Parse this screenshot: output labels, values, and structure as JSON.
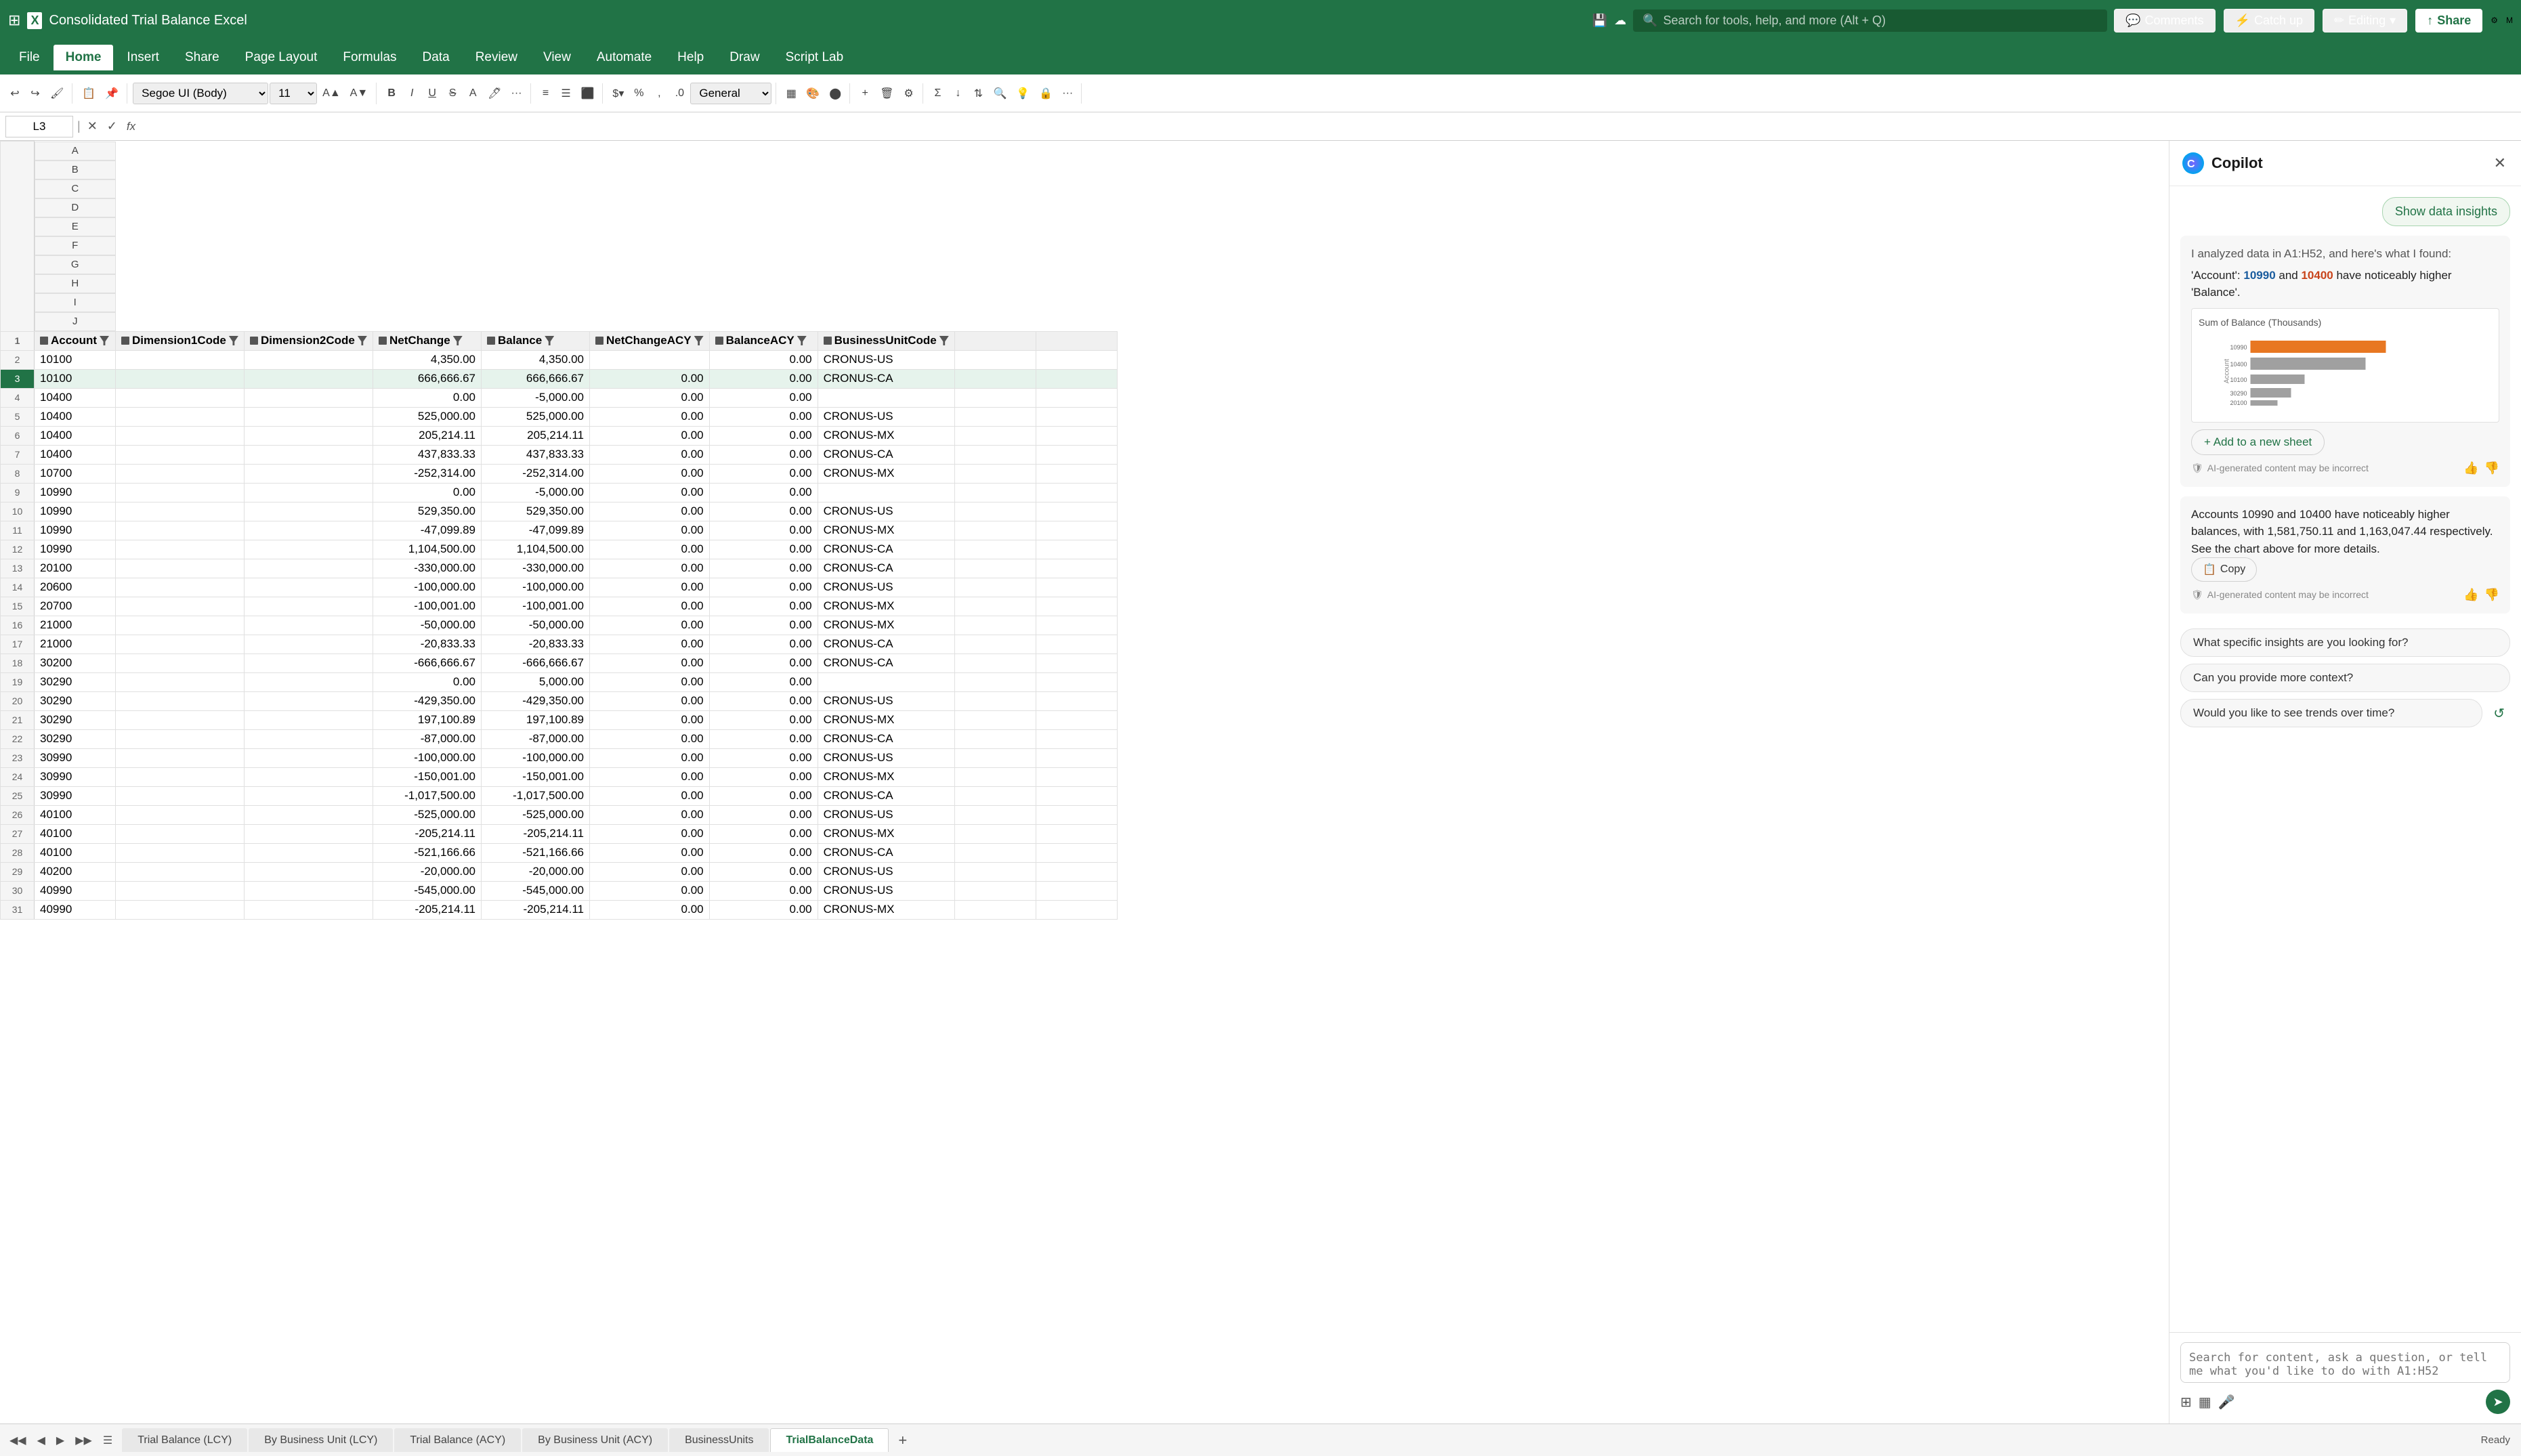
{
  "titleBar": {
    "appName": "Consolidated Trial Balance Excel",
    "searchPlaceholder": "Search for tools, help, and more (Alt + Q)",
    "waffleLabel": "⊞",
    "comments": "Comments",
    "catchup": "Catch up",
    "editing": "Editing",
    "share": "Share",
    "chevronDown": "▾"
  },
  "ribbonTabs": [
    {
      "label": "File",
      "active": false
    },
    {
      "label": "Home",
      "active": true
    },
    {
      "label": "Insert",
      "active": false
    },
    {
      "label": "Share",
      "active": false
    },
    {
      "label": "Page Layout",
      "active": false
    },
    {
      "label": "Formulas",
      "active": false
    },
    {
      "label": "Data",
      "active": false
    },
    {
      "label": "Review",
      "active": false
    },
    {
      "label": "View",
      "active": false
    },
    {
      "label": "Automate",
      "active": false
    },
    {
      "label": "Help",
      "active": false
    },
    {
      "label": "Draw",
      "active": false
    },
    {
      "label": "Script Lab",
      "active": false
    }
  ],
  "formulaBar": {
    "cellRef": "L3",
    "formula": ""
  },
  "fontSelector": "Segoe UI (Body)",
  "fontSize": "11",
  "numberFormat": "General",
  "columns": [
    {
      "label": "A",
      "width": 120
    },
    {
      "label": "B",
      "width": 190
    },
    {
      "label": "C",
      "width": 190
    },
    {
      "label": "D",
      "width": 160
    },
    {
      "label": "E",
      "width": 160
    },
    {
      "label": "F",
      "width": 160
    },
    {
      "label": "G",
      "width": 160
    },
    {
      "label": "H",
      "width": 180
    },
    {
      "label": "I",
      "width": 120
    },
    {
      "label": "J",
      "width": 120
    }
  ],
  "tableHeaders": [
    "Account",
    "Dimension1Code",
    "Dimension2Code",
    "NetChange",
    "Balance",
    "NetChangeACY",
    "BalanceACY",
    "BusinessUnitCode",
    "",
    ""
  ],
  "tableData": [
    {
      "row": 2,
      "a": "10100",
      "b": "",
      "c": "",
      "d": "4,350.00",
      "e": "4,350.00",
      "f": "",
      "g": "0.00",
      "h": "CRONUS-US",
      "selected": false
    },
    {
      "row": 3,
      "a": "10100",
      "b": "",
      "c": "",
      "d": "666,666.67",
      "e": "666,666.67",
      "f": "0.00",
      "g": "0.00",
      "h": "CRONUS-CA",
      "selected": true
    },
    {
      "row": 4,
      "a": "10400",
      "b": "",
      "c": "",
      "d": "0.00",
      "e": "-5,000.00",
      "f": "0.00",
      "g": "0.00",
      "h": "",
      "selected": false
    },
    {
      "row": 5,
      "a": "10400",
      "b": "",
      "c": "",
      "d": "525,000.00",
      "e": "525,000.00",
      "f": "0.00",
      "g": "0.00",
      "h": "CRONUS-US",
      "selected": false
    },
    {
      "row": 6,
      "a": "10400",
      "b": "",
      "c": "",
      "d": "205,214.11",
      "e": "205,214.11",
      "f": "0.00",
      "g": "0.00",
      "h": "CRONUS-MX",
      "selected": false
    },
    {
      "row": 7,
      "a": "10400",
      "b": "",
      "c": "",
      "d": "437,833.33",
      "e": "437,833.33",
      "f": "0.00",
      "g": "0.00",
      "h": "CRONUS-CA",
      "selected": false
    },
    {
      "row": 8,
      "a": "10700",
      "b": "",
      "c": "",
      "d": "-252,314.00",
      "e": "-252,314.00",
      "f": "0.00",
      "g": "0.00",
      "h": "CRONUS-MX",
      "selected": false
    },
    {
      "row": 9,
      "a": "10990",
      "b": "",
      "c": "",
      "d": "0.00",
      "e": "-5,000.00",
      "f": "0.00",
      "g": "0.00",
      "h": "",
      "selected": false
    },
    {
      "row": 10,
      "a": "10990",
      "b": "",
      "c": "",
      "d": "529,350.00",
      "e": "529,350.00",
      "f": "0.00",
      "g": "0.00",
      "h": "CRONUS-US",
      "selected": false
    },
    {
      "row": 11,
      "a": "10990",
      "b": "",
      "c": "",
      "d": "-47,099.89",
      "e": "-47,099.89",
      "f": "0.00",
      "g": "0.00",
      "h": "CRONUS-MX",
      "selected": false
    },
    {
      "row": 12,
      "a": "10990",
      "b": "",
      "c": "",
      "d": "1,104,500.00",
      "e": "1,104,500.00",
      "f": "0.00",
      "g": "0.00",
      "h": "CRONUS-CA",
      "selected": false
    },
    {
      "row": 13,
      "a": "20100",
      "b": "",
      "c": "",
      "d": "-330,000.00",
      "e": "-330,000.00",
      "f": "0.00",
      "g": "0.00",
      "h": "CRONUS-CA",
      "selected": false
    },
    {
      "row": 14,
      "a": "20600",
      "b": "",
      "c": "",
      "d": "-100,000.00",
      "e": "-100,000.00",
      "f": "0.00",
      "g": "0.00",
      "h": "CRONUS-US",
      "selected": false
    },
    {
      "row": 15,
      "a": "20700",
      "b": "",
      "c": "",
      "d": "-100,001.00",
      "e": "-100,001.00",
      "f": "0.00",
      "g": "0.00",
      "h": "CRONUS-MX",
      "selected": false
    },
    {
      "row": 16,
      "a": "21000",
      "b": "",
      "c": "",
      "d": "-50,000.00",
      "e": "-50,000.00",
      "f": "0.00",
      "g": "0.00",
      "h": "CRONUS-MX",
      "selected": false
    },
    {
      "row": 17,
      "a": "21000",
      "b": "",
      "c": "",
      "d": "-20,833.33",
      "e": "-20,833.33",
      "f": "0.00",
      "g": "0.00",
      "h": "CRONUS-CA",
      "selected": false
    },
    {
      "row": 18,
      "a": "30200",
      "b": "",
      "c": "",
      "d": "-666,666.67",
      "e": "-666,666.67",
      "f": "0.00",
      "g": "0.00",
      "h": "CRONUS-CA",
      "selected": false
    },
    {
      "row": 19,
      "a": "30290",
      "b": "",
      "c": "",
      "d": "0.00",
      "e": "5,000.00",
      "f": "0.00",
      "g": "0.00",
      "h": "",
      "selected": false
    },
    {
      "row": 20,
      "a": "30290",
      "b": "",
      "c": "",
      "d": "-429,350.00",
      "e": "-429,350.00",
      "f": "0.00",
      "g": "0.00",
      "h": "CRONUS-US",
      "selected": false
    },
    {
      "row": 21,
      "a": "30290",
      "b": "",
      "c": "",
      "d": "197,100.89",
      "e": "197,100.89",
      "f": "0.00",
      "g": "0.00",
      "h": "CRONUS-MX",
      "selected": false
    },
    {
      "row": 22,
      "a": "30290",
      "b": "",
      "c": "",
      "d": "-87,000.00",
      "e": "-87,000.00",
      "f": "0.00",
      "g": "0.00",
      "h": "CRONUS-CA",
      "selected": false
    },
    {
      "row": 23,
      "a": "30990",
      "b": "",
      "c": "",
      "d": "-100,000.00",
      "e": "-100,000.00",
      "f": "0.00",
      "g": "0.00",
      "h": "CRONUS-US",
      "selected": false
    },
    {
      "row": 24,
      "a": "30990",
      "b": "",
      "c": "",
      "d": "-150,001.00",
      "e": "-150,001.00",
      "f": "0.00",
      "g": "0.00",
      "h": "CRONUS-MX",
      "selected": false
    },
    {
      "row": 25,
      "a": "30990",
      "b": "",
      "c": "",
      "d": "-1,017,500.00",
      "e": "-1,017,500.00",
      "f": "0.00",
      "g": "0.00",
      "h": "CRONUS-CA",
      "selected": false
    },
    {
      "row": 26,
      "a": "40100",
      "b": "",
      "c": "",
      "d": "-525,000.00",
      "e": "-525,000.00",
      "f": "0.00",
      "g": "0.00",
      "h": "CRONUS-US",
      "selected": false
    },
    {
      "row": 27,
      "a": "40100",
      "b": "",
      "c": "",
      "d": "-205,214.11",
      "e": "-205,214.11",
      "f": "0.00",
      "g": "0.00",
      "h": "CRONUS-MX",
      "selected": false
    },
    {
      "row": 28,
      "a": "40100",
      "b": "",
      "c": "",
      "d": "-521,166.66",
      "e": "-521,166.66",
      "f": "0.00",
      "g": "0.00",
      "h": "CRONUS-CA",
      "selected": false
    },
    {
      "row": 29,
      "a": "40200",
      "b": "",
      "c": "",
      "d": "-20,000.00",
      "e": "-20,000.00",
      "f": "0.00",
      "g": "0.00",
      "h": "CRONUS-US",
      "selected": false
    },
    {
      "row": 30,
      "a": "40990",
      "b": "",
      "c": "",
      "d": "-545,000.00",
      "e": "-545,000.00",
      "f": "0.00",
      "g": "0.00",
      "h": "CRONUS-US",
      "selected": false
    },
    {
      "row": 31,
      "a": "40990",
      "b": "",
      "c": "",
      "d": "-205,214.11",
      "e": "-205,214.11",
      "f": "0.00",
      "g": "0.00",
      "h": "CRONUS-MX",
      "selected": false
    }
  ],
  "copilot": {
    "title": "Copilot",
    "showDataInsights": "Show data insights",
    "analyzedNote": "I analyzed data in A1:H52, and here's what I found:",
    "insightText1a": "'Account': ",
    "insightHighlight1": "10990",
    "insightText1b": " and ",
    "insightHighlight2": "10400",
    "insightText1c": " have noticeably higher 'Balance'.",
    "chartTitle": "Sum of Balance (Thousands)",
    "addToSheet": "+ Add to a new sheet",
    "aiDisclaimer": "AI-generated content may be incorrect",
    "insight2": "Accounts 10990 and 10400 have noticeably higher balances, with 1,581,750.11 and 1,163,047.44 respectively. See the chart above for more details.",
    "copyLabel": "Copy",
    "aiDisclaimer2": "AI-generated content may be incorrect",
    "suggestion1": "What specific insights are you looking for?",
    "suggestion2": "Can you provide more context?",
    "suggestion3": "Would you like to see trends over time?",
    "inputPlaceholder": "Search for content, ask a question, or tell me what you'd like to do with A1:H52",
    "icons": {
      "grid": "⊞",
      "table": "▦",
      "mic": "🎤",
      "send": "➤"
    }
  },
  "sheetTabs": [
    {
      "label": "Trial Balance (LCY)",
      "active": false
    },
    {
      "label": "By Business Unit (LCY)",
      "active": false
    },
    {
      "label": "Trial Balance (ACY)",
      "active": false
    },
    {
      "label": "By Business Unit (ACY)",
      "active": false
    },
    {
      "label": "BusinessUnits",
      "active": false
    },
    {
      "label": "TrialBalanceData",
      "active": true
    }
  ],
  "colors": {
    "excelGreen": "#217346",
    "lightGreen": "#e6f3ec",
    "copilotBg": "#f7f7f7",
    "accent": "#217346"
  }
}
